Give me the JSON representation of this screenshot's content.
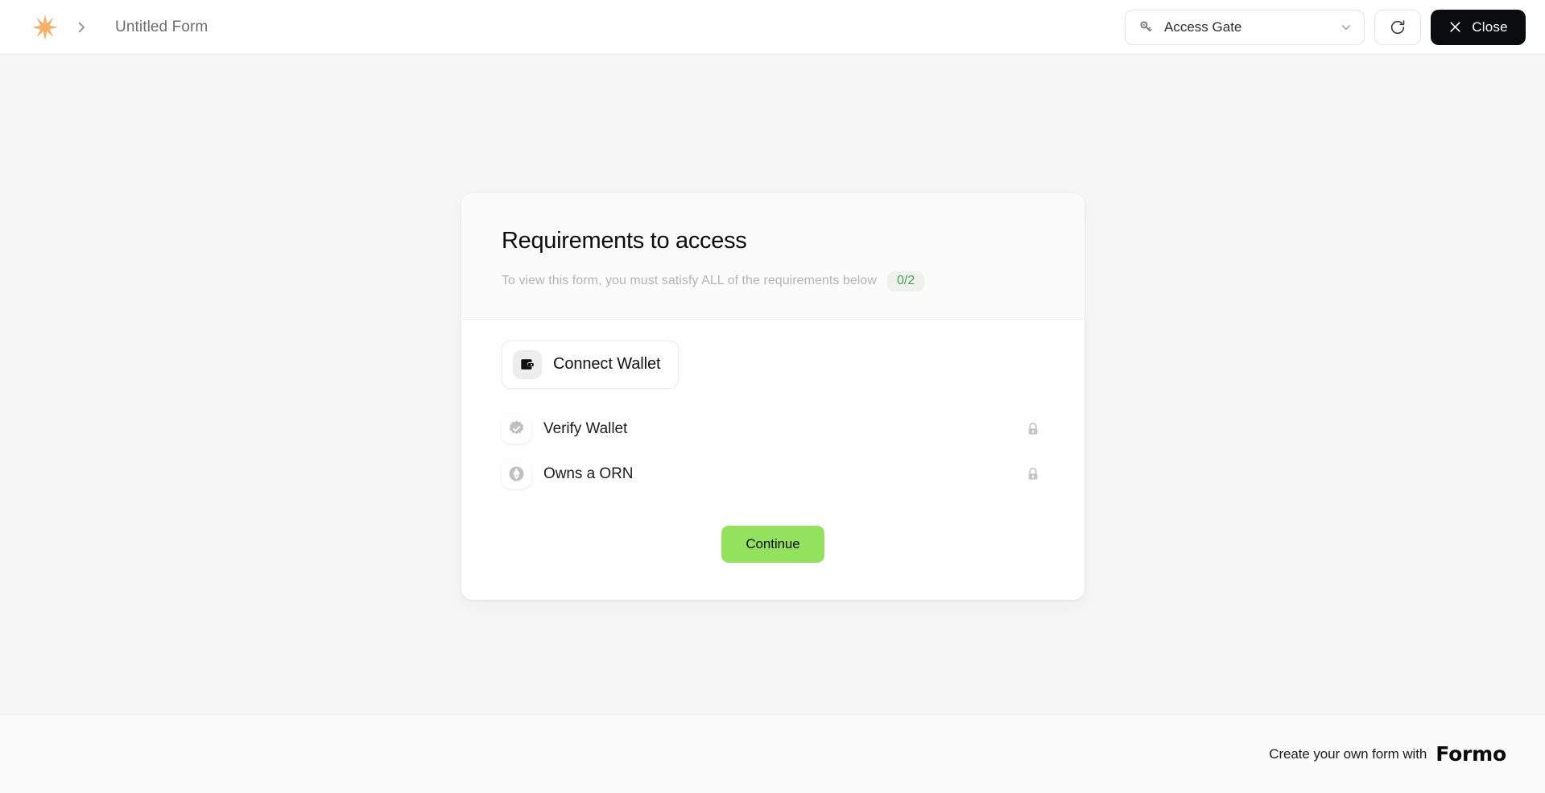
{
  "topbar": {
    "logo_icon": "star-sparkle-icon",
    "breadcrumb_icon": "chevron-right-icon",
    "form_title": "Untitled Form",
    "gate_select": {
      "icon": "key-icon",
      "value": "Access Gate",
      "chevron_icon": "chevron-down-icon"
    },
    "refresh_button": {
      "icon": "refresh-icon",
      "label": ""
    },
    "close_button": {
      "icon": "close-x-icon",
      "label": "Close"
    }
  },
  "card": {
    "title": "Requirements to access",
    "subtitle": "To view this form, you must satisfy ALL of the requirements below",
    "count_badge": "0/2",
    "connect_wallet": {
      "icon": "wallet-icon",
      "label": "Connect Wallet"
    },
    "requirements": [
      {
        "icon": "verified-badge-icon",
        "label": "Verify Wallet",
        "lock_icon": "lock-icon",
        "locked": true
      },
      {
        "icon": "ethereum-icon",
        "label": "Owns a ORN",
        "lock_icon": "lock-icon",
        "locked": true
      }
    ],
    "continue_label": "Continue"
  },
  "footer": {
    "text": "Create your own form with",
    "brand": "Formo"
  },
  "colors": {
    "accent_green": "#93e25d",
    "badge_green_text": "#4aa24a",
    "logo_orange": "#f5b369",
    "close_black": "#0b0c0e",
    "page_bg": "#f6f6f6"
  }
}
